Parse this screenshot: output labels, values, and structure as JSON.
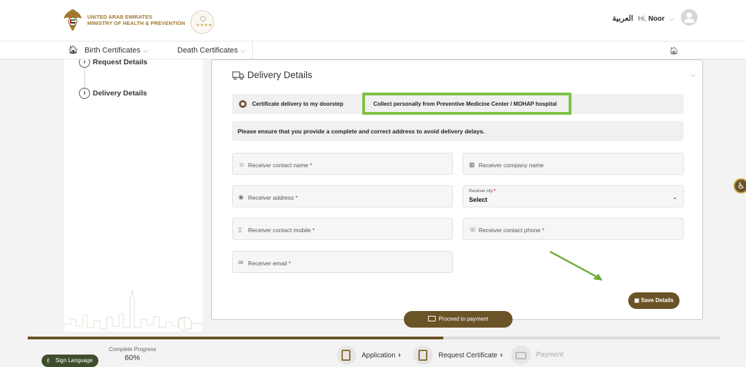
{
  "header": {
    "org_line1": "UNITED ARAB EMIRATES",
    "org_line2": "MINISTRY OF HEALTH & PREVENTION",
    "badge_stars": "★★★★",
    "language_toggle": "العربية",
    "greeting_prefix": "Hi,",
    "user_name": "Noor"
  },
  "nav": {
    "items": [
      {
        "label": "Birth Certificates"
      },
      {
        "label": "Death Certificates"
      }
    ]
  },
  "sidebar": {
    "steps": [
      {
        "label": "Request Details"
      },
      {
        "label": "Delivery Details"
      }
    ]
  },
  "delivery": {
    "title": "Delivery Details",
    "option_doorstep": "Certificate delivery to my doorstep",
    "option_collect": "Collect personally from Preventive Medicine Center / MOHAP hospital",
    "notice": "Please ensure that you provide a complete and correct address to avoid delivery delays.",
    "fields": {
      "contact_name": "Receiver contact name *",
      "company_name": "Receiver company name",
      "address": "Receiver address *",
      "city_label": "Receiver city",
      "city_required": "*",
      "city_value": "Select",
      "contact_mobile": "Receiver contact mobile *",
      "contact_phone": "Receiver contact phone *",
      "email": "Receiver email *"
    },
    "save_button": "Save Details"
  },
  "proceed_button": "Proceed to payment",
  "footer": {
    "sign_language": "Sign Language",
    "progress_label": "Complete Progress",
    "progress_value": "60%",
    "progress_fraction": 0.6,
    "wizard": [
      {
        "label": "Application",
        "state": "done"
      },
      {
        "label": "Request Certificate",
        "state": "current"
      },
      {
        "label": "Payment",
        "state": "disabled"
      }
    ]
  },
  "colors": {
    "brand_brown": "#6b5328",
    "highlight_green": "#7dc243",
    "gold": "#a0792f"
  }
}
